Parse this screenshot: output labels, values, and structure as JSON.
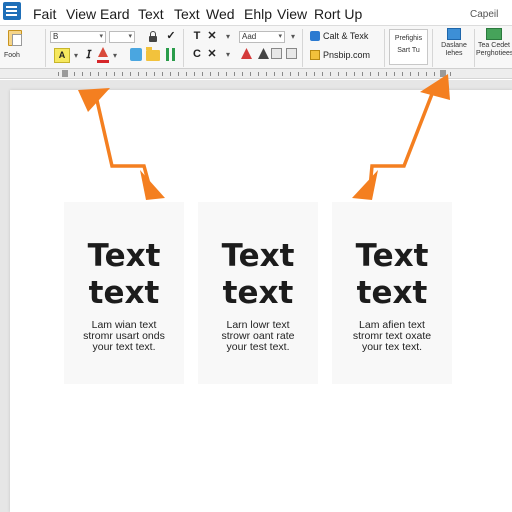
{
  "colors": {
    "accent_arrow": "#f47f20",
    "app_blue": "#1f6fb8",
    "page_bg": "#ffffff",
    "workspace_bg": "#e6e6e6",
    "card_bg": "#f8f8f8"
  },
  "menu": {
    "items": [
      "Fait",
      "View",
      "Eard",
      "Text",
      "Text",
      "Wed",
      "Ehlp",
      "View",
      "Rort Up"
    ],
    "right_label": "Capeil"
  },
  "ribbon": {
    "paste_label": "Fooh",
    "font_name": "B",
    "font_size": "",
    "style_name": "Aad",
    "highlight_label": "A",
    "quick_insert_label": "Calt & Texk",
    "publish_label": "Pnsbip.com",
    "preview_panel_lines": [
      "Prefighis",
      "Sart Tu"
    ],
    "design_lines": [
      "Daslane",
      "Iehes"
    ],
    "tiles_lines": [
      "Tea Cedet",
      "Perghotiees"
    ],
    "icons": [
      "paste-icon",
      "lock-icon",
      "check-icon",
      "bold-icon",
      "strike-icon",
      "dropdown-icon",
      "highlight-icon",
      "italic-icon",
      "font-color-icon",
      "fill-icon",
      "folder-icon",
      "columns-icon",
      "eraser-icon",
      "triangle-icon",
      "box-icon",
      "calendar-icon",
      "shape-icon"
    ]
  },
  "cards": [
    {
      "heading_line1": "Text",
      "heading_line2": "text",
      "body": [
        "Lam wian text",
        "stromr usart onds",
        "your text text."
      ]
    },
    {
      "heading_line1": "Text",
      "heading_line2": "text",
      "body": [
        "Larn lowr text",
        "strowr oant rate",
        "your test text."
      ]
    },
    {
      "heading_line1": "Text",
      "heading_line2": "text",
      "body": [
        "Lam afien text",
        "stromr text oxate",
        "your tex text."
      ]
    }
  ]
}
